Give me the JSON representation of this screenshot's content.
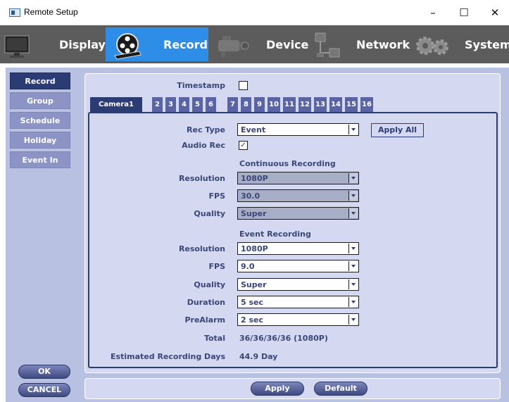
{
  "window": {
    "title": "Remote Setup",
    "minimize": "–",
    "maximize": "☐",
    "close": "✕"
  },
  "nav": {
    "tabs": [
      {
        "label": "Display",
        "icon": "monitor-icon"
      },
      {
        "label": "Record",
        "icon": "film-reel-icon",
        "active": true
      },
      {
        "label": "Device",
        "icon": "camera-icon"
      },
      {
        "label": "Network",
        "icon": "network-icon"
      },
      {
        "label": "System",
        "icon": "gears-icon"
      }
    ]
  },
  "sidebar": {
    "items": [
      {
        "label": "Record",
        "active": true
      },
      {
        "label": "Group"
      },
      {
        "label": "Schedule"
      },
      {
        "label": "Holiday"
      },
      {
        "label": "Event In"
      }
    ],
    "ok_label": "OK",
    "cancel_label": "CANCEL"
  },
  "timestamp": {
    "label": "Timestamp",
    "checked": false
  },
  "camera_tabs": [
    "Camera1",
    "2",
    "3",
    "4",
    "5",
    "6",
    "7",
    "8",
    "9",
    "10",
    "11",
    "12",
    "13",
    "14",
    "15",
    "16"
  ],
  "record": {
    "rec_type_label": "Rec Type",
    "rec_type_value": "Event",
    "apply_all_label": "Apply All",
    "audio_rec_label": "Audio Rec",
    "audio_rec_checked": true,
    "audio_rec_mark": "✓",
    "continuous_title": "Continuous Recording",
    "continuous": {
      "resolution_label": "Resolution",
      "resolution_value": "1080P",
      "fps_label": "FPS",
      "fps_value": "30.0",
      "quality_label": "Quality",
      "quality_value": "Super"
    },
    "event_title": "Event Recording",
    "event": {
      "resolution_label": "Resolution",
      "resolution_value": "1080P",
      "fps_label": "FPS",
      "fps_value": "9.0",
      "quality_label": "Quality",
      "quality_value": "Super",
      "duration_label": "Duration",
      "duration_value": "5 sec",
      "prealarm_label": "PreAlarm",
      "prealarm_value": "2 sec"
    },
    "total_label": "Total",
    "total_value": "36/36/36/36 (1080P)",
    "est_days_label": "Estimated Recording Days",
    "est_days_value": "44.9 Day"
  },
  "footer": {
    "apply_label": "Apply",
    "default_label": "Default"
  },
  "colors": {
    "accent": "#2e8de6",
    "navy": "#2b3b74",
    "panel": "#d4d9f1",
    "background": "#b8c1e2"
  }
}
